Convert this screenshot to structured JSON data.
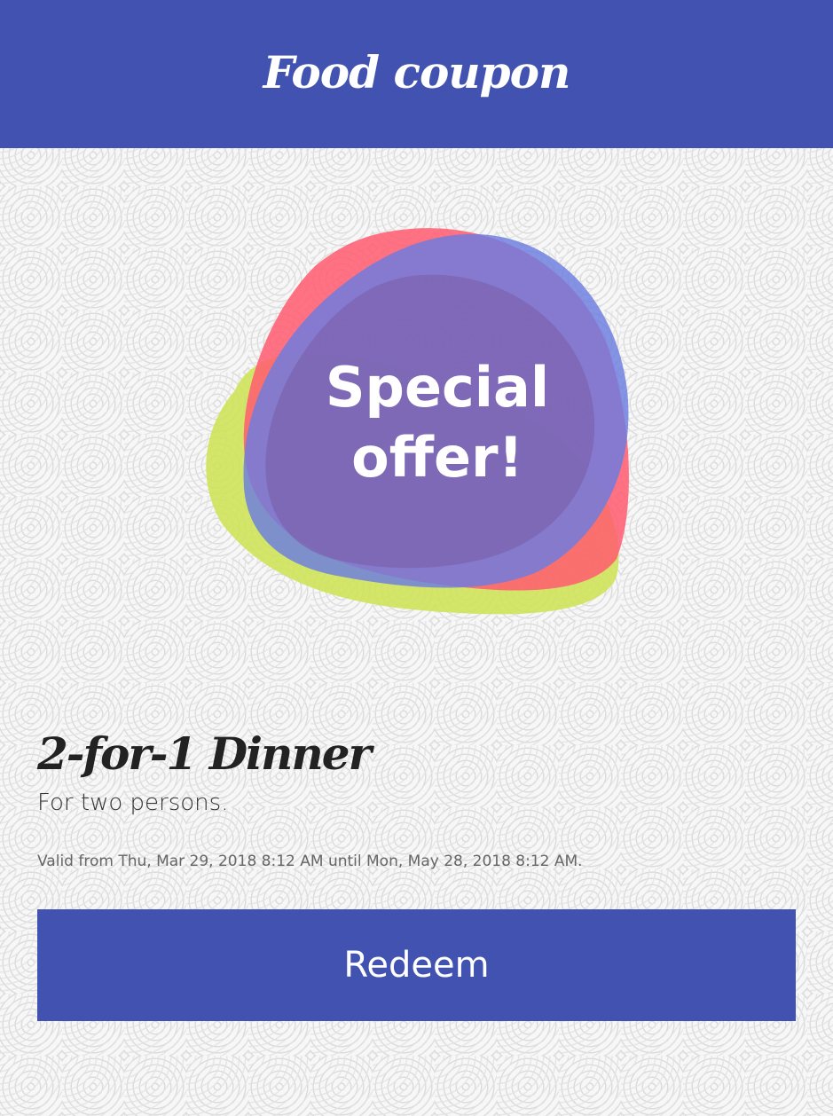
{
  "header": {
    "title": "Food coupon"
  },
  "offer_graphic": {
    "line1": "Special",
    "line2": "offer!",
    "colors": {
      "lime": "#cfe35a",
      "red": "#ff5a70",
      "blue": "#6b7de0",
      "overlap": "#7c64b0"
    }
  },
  "coupon": {
    "title": "2-for-1 Dinner",
    "subtitle": "For two persons.",
    "validity": "Valid from Thu, Mar 29, 2018 8:12 AM until Mon, May 28, 2018 8:12 AM."
  },
  "actions": {
    "redeem_label": "Redeem"
  },
  "theme": {
    "primary": "#4252b0"
  }
}
